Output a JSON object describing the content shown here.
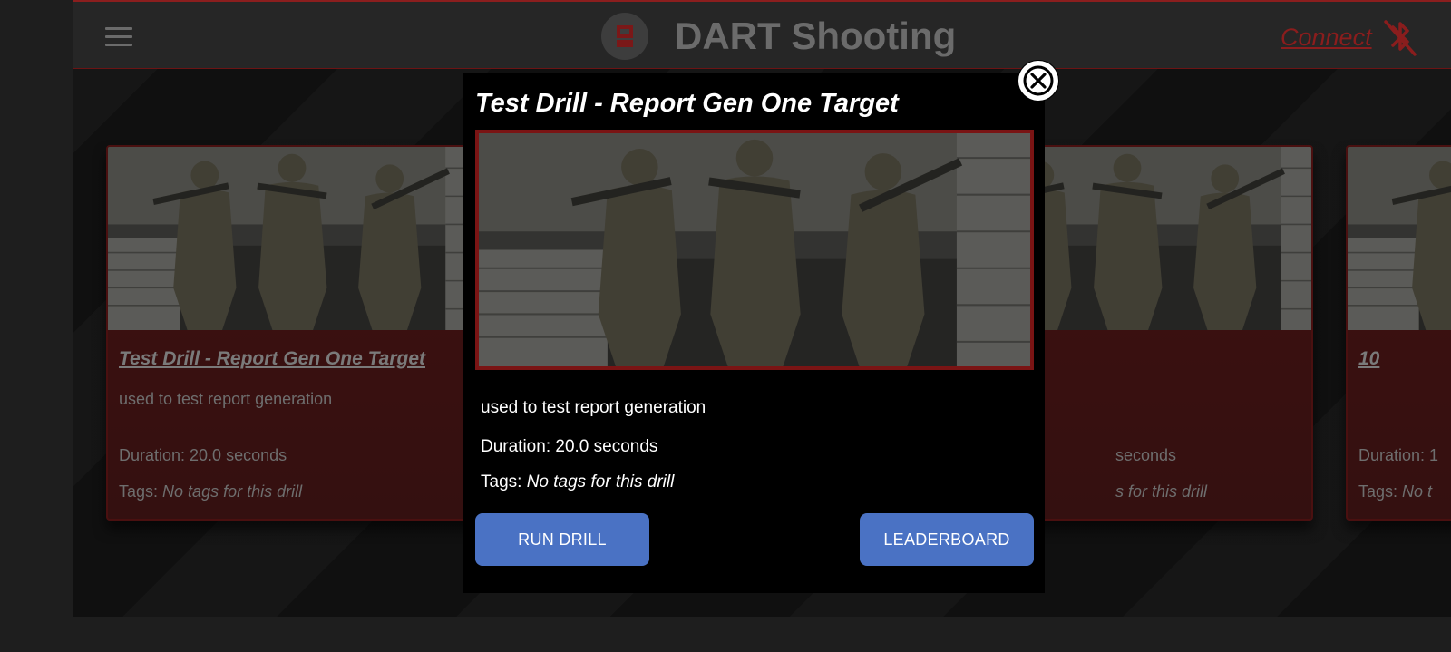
{
  "header": {
    "title": "DART Shooting",
    "connect_label": "Connect",
    "icons": {
      "menu": "hamburger-menu-icon",
      "logo": "dart-logo-icon",
      "bluetooth": "bluetooth-disabled-icon"
    }
  },
  "cards": [
    {
      "title": "Test Drill - Report Gen One Target",
      "description": "used to test report generation",
      "duration": "Duration: 20.0 seconds",
      "tags_label": "Tags:",
      "tags_value": "No tags for this drill"
    },
    {
      "title": "",
      "description": "",
      "duration": "seconds",
      "tags_label": "",
      "tags_value": "s for this drill"
    },
    {
      "title": "10",
      "description": "",
      "duration": "Duration: 1",
      "tags_label": "Tags:",
      "tags_value": "No t"
    }
  ],
  "modal": {
    "title": "Test Drill - Report Gen One Target",
    "description": "used to test report generation",
    "duration": "Duration: 20.0 seconds",
    "tags_label": "Tags:",
    "tags_value": "No tags for this drill",
    "run_button": "RUN DRILL",
    "leaderboard_button": "LEADERBOARD",
    "close_icon": "close-icon"
  },
  "colors": {
    "accent_red": "#8a1d1d",
    "button_blue": "#4a72c4",
    "header_bg": "#262626",
    "card_bg": "#3f1010"
  }
}
